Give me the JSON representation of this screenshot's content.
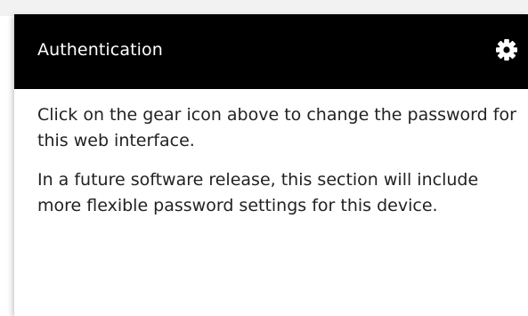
{
  "panel": {
    "title": "Authentication",
    "header_bg": "#000000",
    "header_text_color": "#ffffff",
    "settings_icon": "gear-icon",
    "paragraphs": [
      "Click on the gear icon above to change the password for this web interface.",
      "In a future software release, this section will include more flexible password settings for this device."
    ]
  }
}
